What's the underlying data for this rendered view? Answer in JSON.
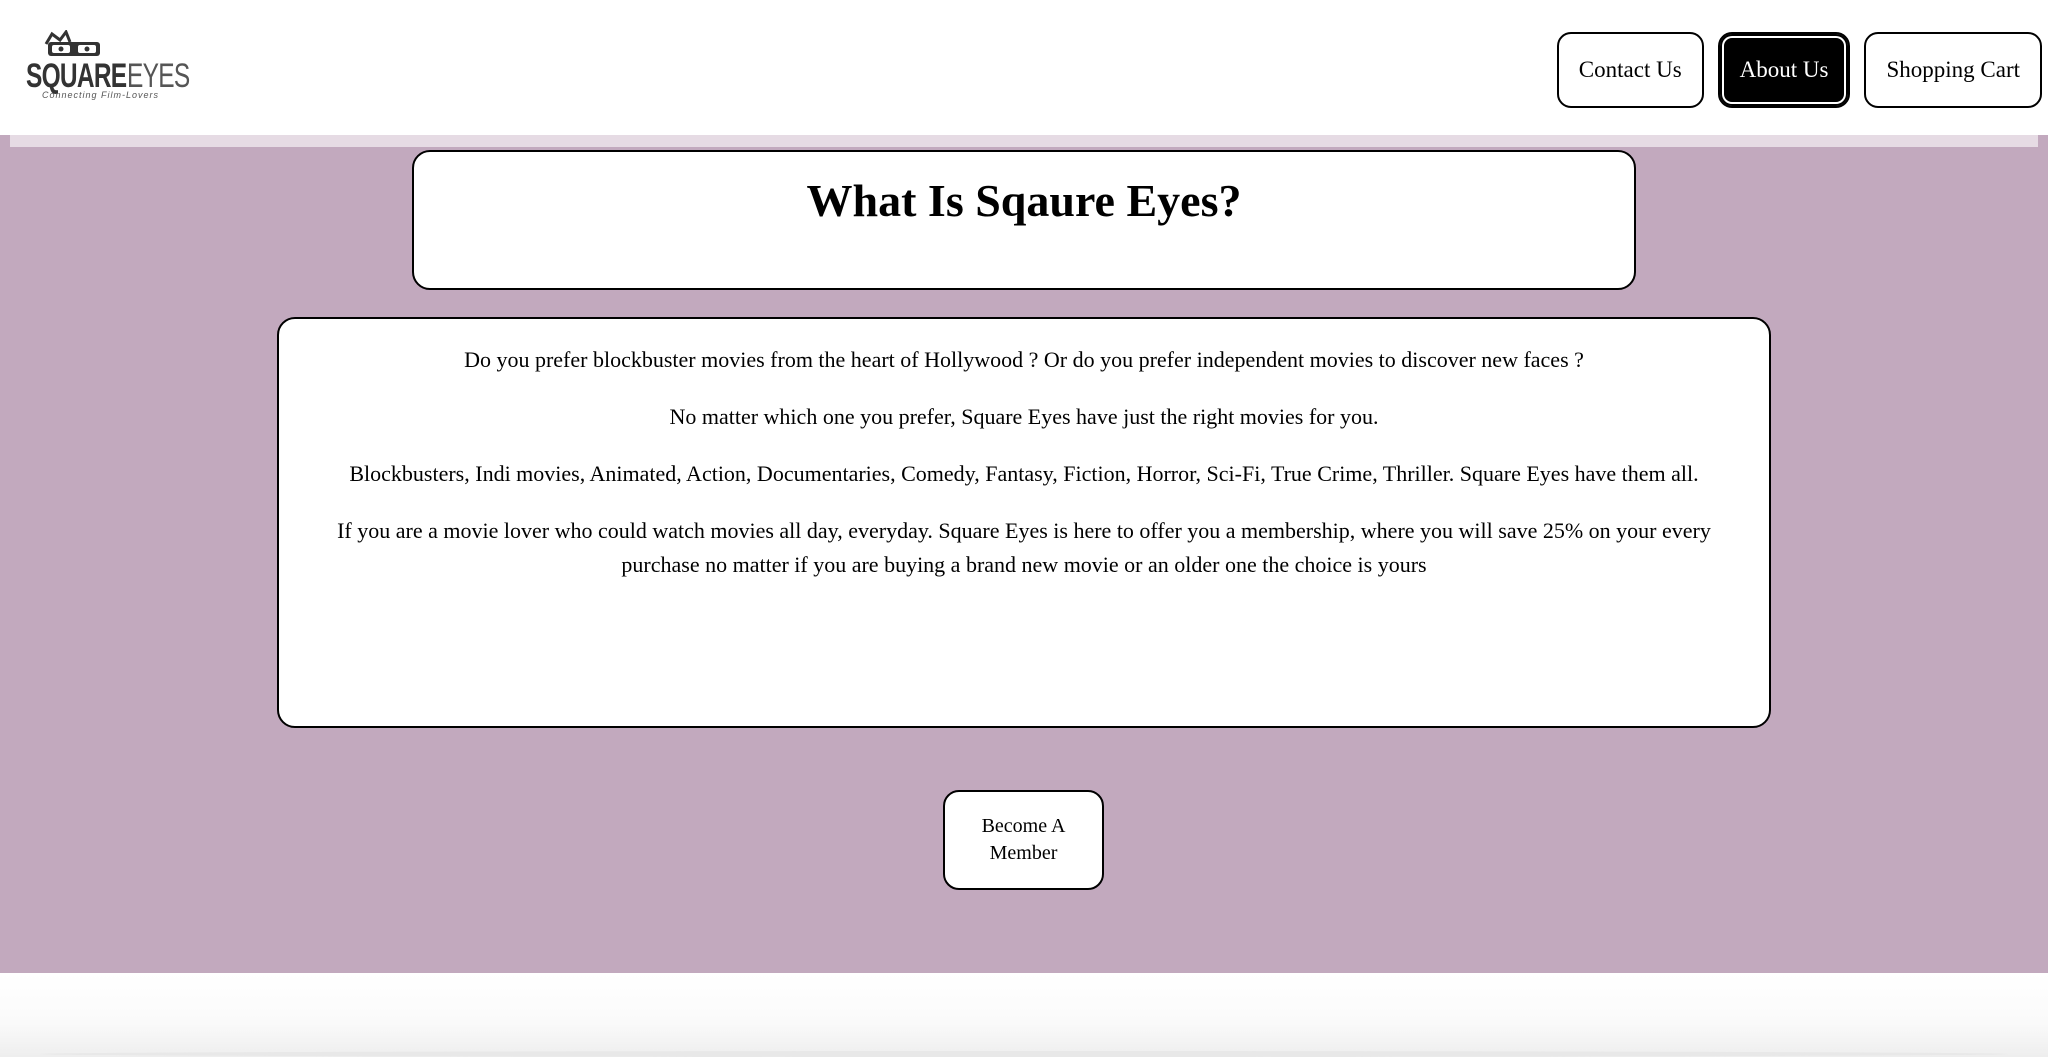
{
  "header": {
    "logo": {
      "brand_bold": "SQUARE",
      "brand_light": "EYES",
      "tagline": "Connecting Film-Lovers"
    },
    "nav": [
      {
        "label": "Contact Us",
        "active": false
      },
      {
        "label": "About Us",
        "active": true
      },
      {
        "label": "Shopping Cart",
        "active": false
      }
    ]
  },
  "main": {
    "title": "What Is Sqaure Eyes?",
    "paragraphs": [
      "Do you prefer blockbuster movies from the heart of Hollywood ? Or do you prefer independent movies to discover new faces ?",
      "No matter which one you prefer, Square Eyes have just the right movies for you.",
      "Blockbusters, Indi movies, Animated, Action, Documentaries, Comedy, Fantasy, Fiction, Horror, Sci-Fi, True Crime, Thriller. Square Eyes have them all.",
      "If you are a movie lover who could watch movies all day, everyday. Square Eyes is here to offer you a membership, where you will save 25% on your every purchase no matter if you are buying a brand new movie or an older one the choice is yours"
    ],
    "cta": {
      "line1": "Become A",
      "line2": "Member"
    }
  },
  "colors": {
    "background": "#c2a9be",
    "panel": "#ffffff",
    "active_nav": "#000000"
  },
  "icons": {
    "logo": "3d-glasses-icon"
  }
}
